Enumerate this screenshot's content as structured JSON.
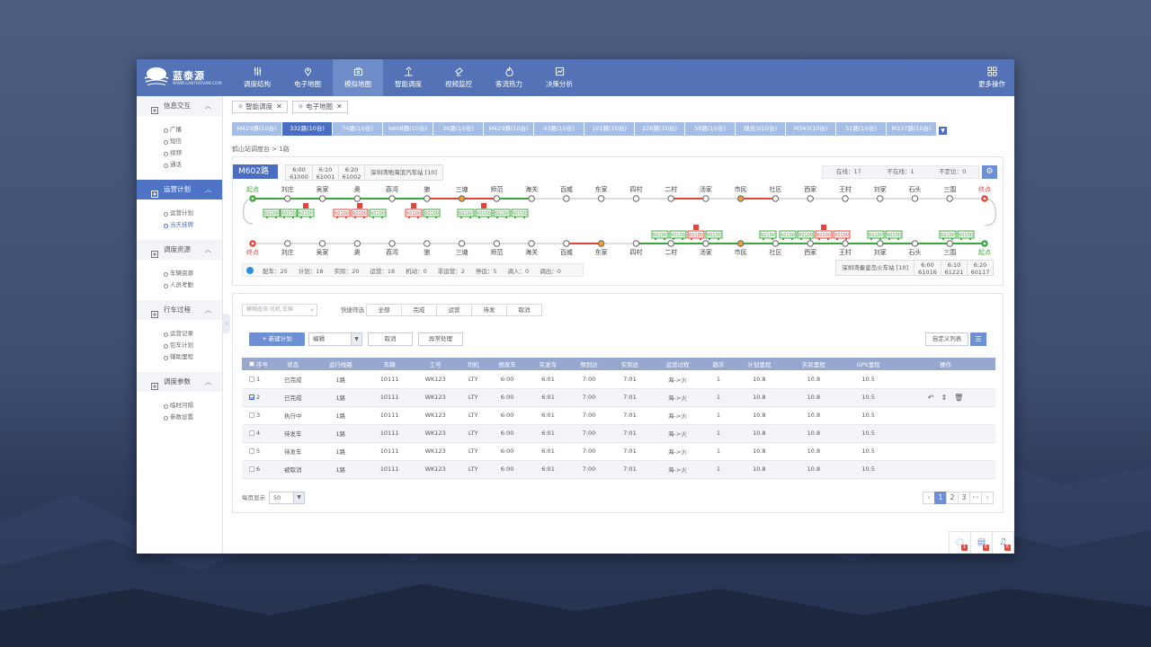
{
  "brand": {
    "name": "蓝泰源",
    "sub": "WWW.LANTAIYUAN.COM"
  },
  "nav": [
    {
      "label": "调度结构",
      "icon": "sliders-icon"
    },
    {
      "label": "电子地图",
      "icon": "map-pin-icon"
    },
    {
      "label": "模拟地图",
      "icon": "bag-icon",
      "active": true
    },
    {
      "label": "智能调度",
      "icon": "dispatch-icon"
    },
    {
      "label": "视频监控",
      "icon": "camera-icon"
    },
    {
      "label": "客流热力",
      "icon": "fire-icon"
    },
    {
      "label": "决策分析",
      "icon": "analysis-icon"
    }
  ],
  "more_label": "更多操作",
  "sidebar": [
    {
      "label": "信息交互",
      "icon": "message-icon",
      "items": [
        "广播",
        "短信",
        "视频",
        "通话"
      ]
    },
    {
      "label": "运营计划",
      "icon": "plan-icon",
      "active": true,
      "items": [
        "运营计划",
        "当天挂牌"
      ],
      "active_item": 1
    },
    {
      "label": "调度资源",
      "icon": "resource-icon",
      "items": [
        "车辆资源",
        "人员考勤"
      ]
    },
    {
      "label": "行车过程",
      "icon": "process-icon",
      "items": [
        "运营记录",
        "包车计划",
        "辅助里程"
      ]
    },
    {
      "label": "调度参数",
      "icon": "chart-icon",
      "items": [
        "临时问隔",
        "参数设置"
      ]
    }
  ],
  "tabs": [
    "智能调度",
    "电子地图"
  ],
  "routes": [
    "M429路(10台)",
    "332路(10台)",
    "74路(10台)",
    "b608路(10台)",
    "36路(10台)",
    "M429路(10台)",
    "43路(10台)",
    "101路(10台)",
    "226路(10台)",
    "58路(10台)",
    "观光3(10台)",
    "M343(10台)",
    "51路(10台)",
    "M337路(10台)"
  ],
  "active_route": 1,
  "breadcrumb": "鹤山站调度台 > 1路",
  "line": {
    "name": "M602路",
    "departures_top": [
      {
        "time": "6:00",
        "bus": "61000"
      },
      {
        "time": "6:10",
        "bus": "61001"
      },
      {
        "time": "6:20",
        "bus": "61002"
      }
    ],
    "terminal_top": "深圳湾地海滨汽车站 [10]",
    "stats": {
      "online": "在线：17",
      "offline": "不在线：1",
      "unlocated": "不定位：0"
    },
    "stations_top": [
      "起点",
      "刘庄",
      "吴家",
      "奥",
      "荔湾",
      "狼",
      "三塘",
      "师范",
      "海关",
      "百威",
      "东家",
      "四村",
      "二村",
      "汤家",
      "市民",
      "社区",
      "西家",
      "王村",
      "刘家",
      "石头",
      "三围",
      "终点"
    ],
    "stations_bottom": [
      "终点",
      "刘庄",
      "吴家",
      "奥",
      "荔湾",
      "狼",
      "三塘",
      "师范",
      "海关",
      "百威",
      "东家",
      "四村",
      "二村",
      "汤家",
      "市民",
      "社区",
      "西家",
      "王村",
      "刘家",
      "石头",
      "三围",
      "起点"
    ],
    "bus_label": "60100",
    "summary": [
      "配车：25",
      "计划：18",
      "实际：20",
      "运营：18",
      "机动：0",
      "非运营：2",
      "停运：5",
      "调入：0",
      "调出：0"
    ],
    "terminal_bottom": "深圳湾秦皇岛火车站 [10]",
    "departures_bottom": [
      {
        "time": "6:00",
        "bus": "61016"
      },
      {
        "time": "6:10",
        "bus": "61221"
      },
      {
        "time": "6:20",
        "bus": "60117"
      }
    ],
    "colors": {
      "green": "#3aa83a",
      "red": "#e2453b",
      "orange": "#f0a030"
    }
  },
  "search_placeholder": "模糊查询 司机 车辆",
  "quick_filter_label": "快捷筛选",
  "filters": [
    "全部",
    "完成",
    "运营",
    "待发",
    "取消"
  ],
  "toolbar": {
    "add": "+ 新建计划",
    "edit_select": "编辑",
    "cancel": "取消",
    "exception": "异常处理",
    "custom_cols": "自定义列表"
  },
  "table": {
    "headers": [
      "序号",
      "状态",
      "运行线路",
      "车辆",
      "工号",
      "司机",
      "预发车",
      "实发车",
      "预到达",
      "实到达",
      "运营过程",
      "趟次",
      "计划里程",
      "实际里程",
      "GPS里程",
      "操作"
    ],
    "rows": [
      {
        "checked": false,
        "cells": [
          "1",
          "已完成",
          "1路",
          "10111",
          "WK123",
          "LTY",
          "6:00",
          "6:01",
          "7:00",
          "7:01",
          "海->火",
          "1",
          "10.8",
          "10.8",
          "10.5"
        ]
      },
      {
        "checked": true,
        "cells": [
          "2",
          "已完成",
          "1路",
          "10111",
          "WK123",
          "LTY",
          "6:00",
          "6:01",
          "7:00",
          "7:01",
          "海->火",
          "1",
          "10.8",
          "10.8",
          "10.5"
        ],
        "ops": true
      },
      {
        "checked": false,
        "cells": [
          "3",
          "执行中",
          "1路",
          "10111",
          "WK123",
          "LTY",
          "6:00",
          "6:01",
          "7:00",
          "7:01",
          "海->火",
          "1",
          "10.8",
          "10.8",
          "10.5"
        ]
      },
      {
        "checked": false,
        "cells": [
          "4",
          "待发车",
          "1路",
          "10111",
          "WK123",
          "LTY",
          "6:00",
          "6:01",
          "7:00",
          "7:01",
          "海->火",
          "1",
          "10.8",
          "10.8",
          "10.5"
        ]
      },
      {
        "checked": false,
        "cells": [
          "5",
          "待发车",
          "1路",
          "10111",
          "WK123",
          "LTY",
          "6:00",
          "6:01",
          "7:00",
          "7:01",
          "海->火",
          "1",
          "10.8",
          "10.8",
          "10.5"
        ]
      },
      {
        "checked": false,
        "cells": [
          "6",
          "被取消",
          "1路",
          "10111",
          "WK123",
          "LTY",
          "6:00",
          "6:01",
          "7:00",
          "7:01",
          "海->火",
          "1",
          "10.8",
          "10.8",
          "10.5"
        ]
      }
    ]
  },
  "page_size_label": "每页显示",
  "page_size": "50",
  "pages": [
    "1",
    "2",
    "3",
    "···"
  ],
  "corner_badges": [
    "1",
    "6",
    "6"
  ]
}
